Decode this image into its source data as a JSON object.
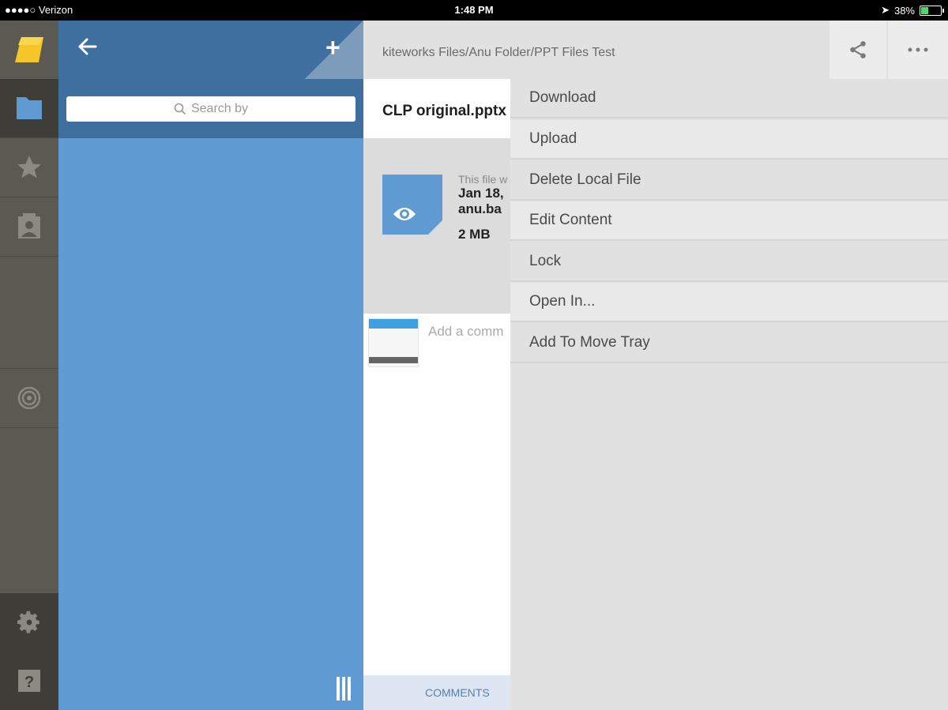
{
  "status_bar": {
    "carrier": "●●●●○ Verizon",
    "time": "1:48 PM",
    "battery": "38%",
    "battery_level": 0.38
  },
  "rail": {
    "items": [
      {
        "icon": "logo-icon"
      },
      {
        "icon": "folder-icon"
      },
      {
        "icon": "star-icon"
      },
      {
        "icon": "contact-icon"
      },
      {
        "icon": "target-icon"
      },
      {
        "icon": "gear-icon"
      },
      {
        "icon": "help-icon"
      }
    ]
  },
  "files_panel": {
    "search_placeholder": "Search by"
  },
  "detail": {
    "path": "kiteworks Files/Anu Folder/PPT Files Test",
    "filename": "CLP original.pptx",
    "info_note": "This file w",
    "info_date": "Jan 18,",
    "info_user": "anu.ba",
    "info_size": "2 MB",
    "comment_placeholder": "Add a comm",
    "tab_comments": "COMMENTS"
  },
  "menu": {
    "items": [
      {
        "label": "Download"
      },
      {
        "label": "Upload"
      },
      {
        "label": "Delete Local File"
      },
      {
        "label": "Edit Content"
      },
      {
        "label": "Lock"
      },
      {
        "label": "Open In..."
      },
      {
        "label": "Add To Move Tray"
      }
    ]
  },
  "colors": {
    "rail": "#5a5a52",
    "panel": "#5f9ad2",
    "panel_header": "#3f6f9f",
    "menu": "#e1e1e1"
  }
}
